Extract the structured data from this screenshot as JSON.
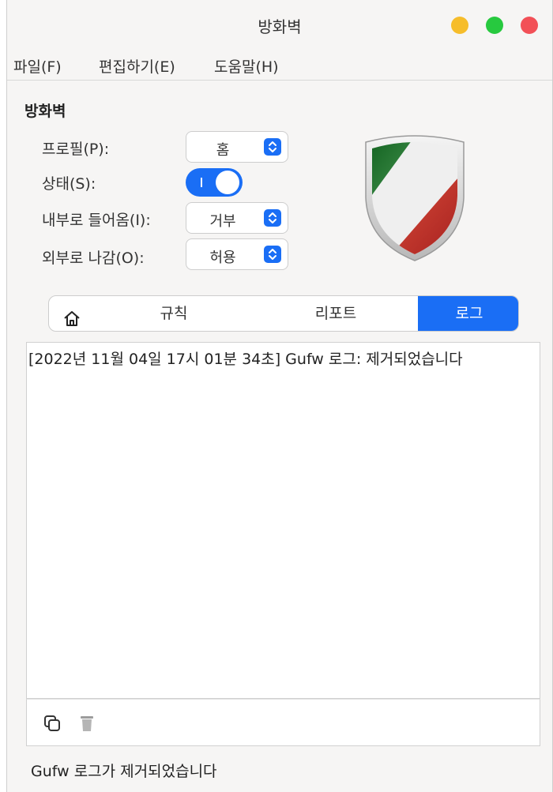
{
  "window": {
    "title": "방화벽"
  },
  "menubar": {
    "items": [
      "파일(F)",
      "편집하기(E)",
      "도움말(H)"
    ]
  },
  "firewall": {
    "section_title": "방화벽",
    "profile": {
      "label": "프로필(P):",
      "value": "홈"
    },
    "status": {
      "label": "상태(S):",
      "on": true
    },
    "incoming": {
      "label": "내부로 들어옴(I):",
      "value": "거부"
    },
    "outgoing": {
      "label": "외부로 나감(O):",
      "value": "허용"
    }
  },
  "tabs": {
    "items": [
      {
        "label": "",
        "icon": "home-icon"
      },
      {
        "label": "규칙"
      },
      {
        "label": "리포트"
      },
      {
        "label": "로그",
        "active": true
      }
    ]
  },
  "log": {
    "lines": [
      "[2022년 11월 04일 17시 01분 34초] Gufw 로그: 제거되었습니다"
    ],
    "toolbar": {
      "copy_icon": "copy-icon",
      "delete_icon": "trash-icon"
    }
  },
  "statusbar": {
    "text": "Gufw 로그가 제거되었습니다"
  },
  "colors": {
    "accent": "#1a6ef5",
    "close": "#f25057",
    "minimize": "#f6bd2b",
    "maximize": "#27c93f"
  }
}
